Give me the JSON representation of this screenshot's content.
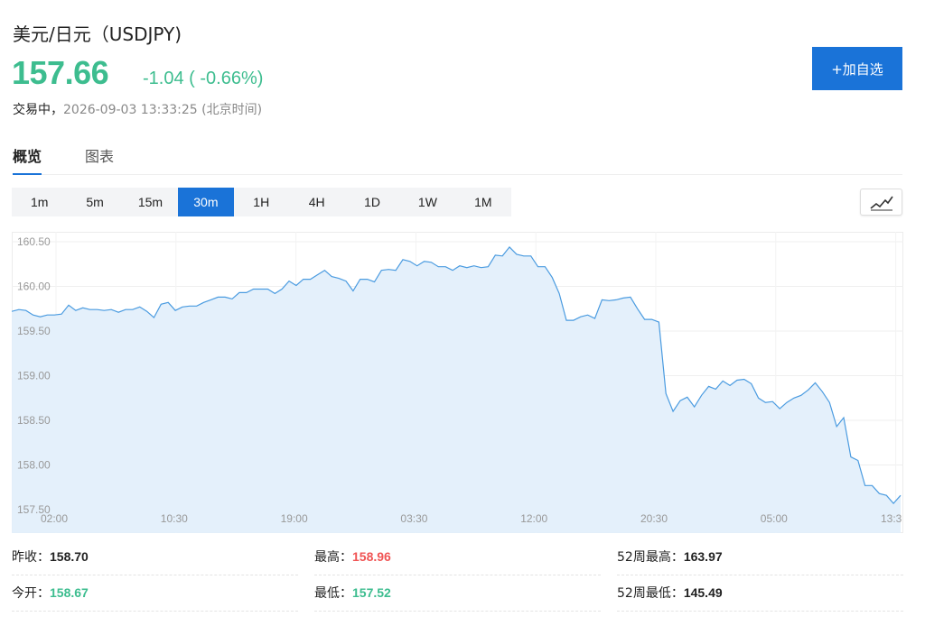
{
  "header": {
    "title": "美元/日元（USDJPY)",
    "price": "157.66",
    "change": "-1.04 ( -0.66%)",
    "status_label": "交易中，",
    "timestamp": "2026-09-03 13:33:25 (北京时间)",
    "add_button": "+加自选"
  },
  "tabs": [
    {
      "label": "概览",
      "active": true
    },
    {
      "label": "图表",
      "active": false
    }
  ],
  "intervals": [
    "1m",
    "5m",
    "15m",
    "30m",
    "1H",
    "4H",
    "1D",
    "1W",
    "1M"
  ],
  "active_interval": "30m",
  "chart_icon": "line-chart-icon",
  "colors": {
    "accent": "#1a73d8",
    "up": "#f05454",
    "down": "#3dbd8f",
    "line": "#4a9be0",
    "fill": "#e3effb"
  },
  "chart_data": {
    "type": "area",
    "x_tick_labels": [
      "02:00",
      "10:30",
      "19:00",
      "03:30",
      "12:00",
      "20:30",
      "05:00",
      "13:3"
    ],
    "y_tick_labels": [
      "160.50",
      "160.00",
      "159.50",
      "159.00",
      "158.50",
      "158.00",
      "157.50"
    ],
    "ylim": [
      157.5,
      160.6
    ],
    "grid": true,
    "values": [
      159.72,
      159.74,
      159.73,
      159.68,
      159.66,
      159.68,
      159.68,
      159.69,
      159.79,
      159.73,
      159.76,
      159.74,
      159.74,
      159.73,
      159.74,
      159.71,
      159.74,
      159.74,
      159.77,
      159.72,
      159.65,
      159.8,
      159.82,
      159.73,
      159.77,
      159.78,
      159.78,
      159.82,
      159.85,
      159.88,
      159.88,
      159.86,
      159.93,
      159.93,
      159.97,
      159.97,
      159.97,
      159.92,
      159.97,
      160.06,
      160.01,
      160.08,
      160.08,
      160.13,
      160.18,
      160.11,
      160.09,
      160.06,
      159.95,
      160.08,
      160.08,
      160.05,
      160.18,
      160.19,
      160.18,
      160.3,
      160.28,
      160.23,
      160.28,
      160.27,
      160.22,
      160.22,
      160.18,
      160.23,
      160.21,
      160.23,
      160.21,
      160.22,
      160.35,
      160.34,
      160.44,
      160.36,
      160.34,
      160.34,
      160.22,
      160.22,
      160.1,
      159.92,
      159.62,
      159.62,
      159.66,
      159.68,
      159.64,
      159.85,
      159.84,
      159.85,
      159.87,
      159.88,
      159.75,
      159.63,
      159.63,
      159.6,
      158.8,
      158.6,
      158.72,
      158.76,
      158.65,
      158.78,
      158.88,
      158.85,
      158.94,
      158.89,
      158.95,
      158.96,
      158.91,
      158.75,
      158.7,
      158.71,
      158.63,
      158.7,
      158.75,
      158.78,
      158.84,
      158.92,
      158.82,
      158.7,
      158.43,
      158.53,
      158.09,
      158.05,
      157.77,
      157.77,
      157.68,
      157.66,
      157.57,
      157.66
    ]
  },
  "stats": [
    {
      "label": "昨收：",
      "value": "158.70",
      "tone": "neutral"
    },
    {
      "label": "最高：",
      "value": "158.96",
      "tone": "up"
    },
    {
      "label": "52周最高：",
      "value": "163.97",
      "tone": "neutral"
    },
    {
      "label": "今开：",
      "value": "158.67",
      "tone": "down"
    },
    {
      "label": "最低：",
      "value": "157.52",
      "tone": "down"
    },
    {
      "label": "52周最低：",
      "value": "145.49",
      "tone": "neutral"
    }
  ]
}
